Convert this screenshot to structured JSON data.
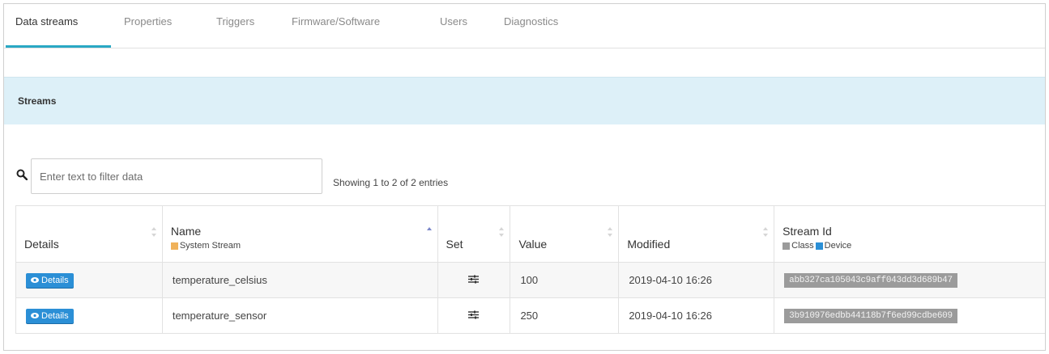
{
  "tabs": [
    {
      "label": "Data streams",
      "active": true
    },
    {
      "label": "Properties"
    },
    {
      "label": "Triggers"
    },
    {
      "label": "Firmware/Software"
    },
    {
      "label": "Users"
    },
    {
      "label": "Diagnostics"
    }
  ],
  "streams": {
    "title": "Streams",
    "filter": {
      "placeholder": "Enter text to filter data",
      "value": ""
    },
    "entries_info": "Showing 1 to 2 of 2 entries",
    "columns": {
      "details": "Details",
      "name": "Name",
      "name_sub": "System Stream",
      "set": "Set",
      "value": "Value",
      "modified": "Modified",
      "stream_id": "Stream Id",
      "stream_id_sub_class": "Class",
      "stream_id_sub_device": "Device"
    },
    "rows": [
      {
        "details_label": "Details",
        "name": "temperature_celsius",
        "value": "100",
        "modified": "2019-04-10 16:26",
        "stream_id": "abb327ca105043c9aff043dd3d689b47"
      },
      {
        "details_label": "Details",
        "name": "temperature_sensor",
        "value": "250",
        "modified": "2019-04-10 16:26",
        "stream_id": "3b910976edbb44118b7f6ed99cdbe609"
      }
    ]
  },
  "colors": {
    "accent": "#2aa8c4",
    "header_bg": "#ddf0f8",
    "button": "#2b8fd6",
    "system_stream_chip": "#f0b25a",
    "class_chip": "#9b9b9b",
    "device_chip": "#2b8fd6",
    "stream_id_bg": "#9b9b9b"
  },
  "icons": {
    "search": "search-icon",
    "sort": "sort-icon",
    "set": "sliders-icon",
    "details": "eye-icon"
  }
}
